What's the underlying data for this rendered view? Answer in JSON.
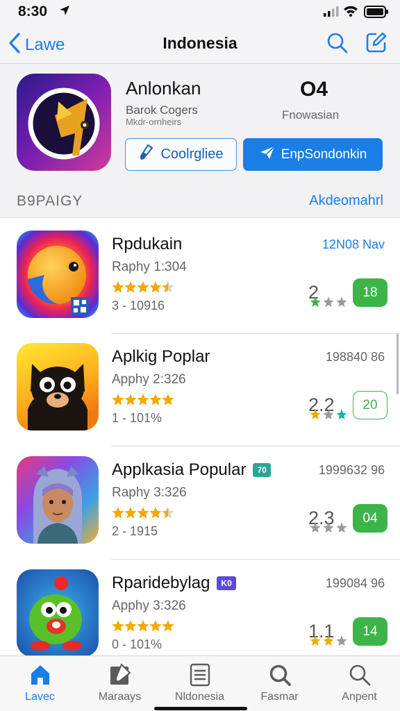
{
  "status_bar": {
    "time": "8:30"
  },
  "nav": {
    "back_label": "Lawe",
    "title": "Indonesia"
  },
  "featured": {
    "title": "Anlonkan",
    "subtitle_1": "Barok Cogers",
    "subtitle_2": "Mkdr-ornheirs",
    "glyph": "O4",
    "glyph_label": "Fnowasian",
    "button_outline_label": "Coolrgliee",
    "button_primary_label": "EnpSondonkin"
  },
  "section": {
    "header": "B9PAIGY",
    "link": "Akdeomahrl"
  },
  "apps": [
    {
      "name": "Rpdukain",
      "badge": "",
      "sub": "Raphy 1:304",
      "range": "3 - 10916",
      "meta": "12N08 Nav",
      "score": "2",
      "pill": "18",
      "rating": 4.5
    },
    {
      "name": "Aplkig Poplar",
      "badge": "",
      "sub": "Apphy 2:326",
      "range": "1 - 101%",
      "meta": "198840  86",
      "score": "2.2",
      "pill": "20",
      "rating": 5
    },
    {
      "name": "Applkasia Popular",
      "badge": "70",
      "sub": "Raphy 3:326",
      "range": "2 - 1915",
      "meta": "1999632  96",
      "score": "2.3",
      "pill": "04",
      "rating": 4.5
    },
    {
      "name": "Rparidebylag",
      "badge": "K0",
      "sub": "Apphy 3:326",
      "range": "0 - 101%",
      "meta": "199084  96",
      "score": "1.1",
      "pill": "14",
      "rating": 5
    }
  ],
  "tabs": [
    {
      "label": "Lavec",
      "icon": "home-icon"
    },
    {
      "label": "Maraays",
      "icon": "compose-icon"
    },
    {
      "label": "Nldonesia",
      "icon": "document-icon"
    },
    {
      "label": "Fasmar",
      "icon": "search-icon"
    },
    {
      "label": "Anpent",
      "icon": "search-icon"
    }
  ],
  "colors": {
    "accent": "#1a7ee6",
    "green": "#3cb44a",
    "star": "#f2a900",
    "badge_teal": "#2aa597",
    "badge_purple": "#5b4bd6"
  }
}
